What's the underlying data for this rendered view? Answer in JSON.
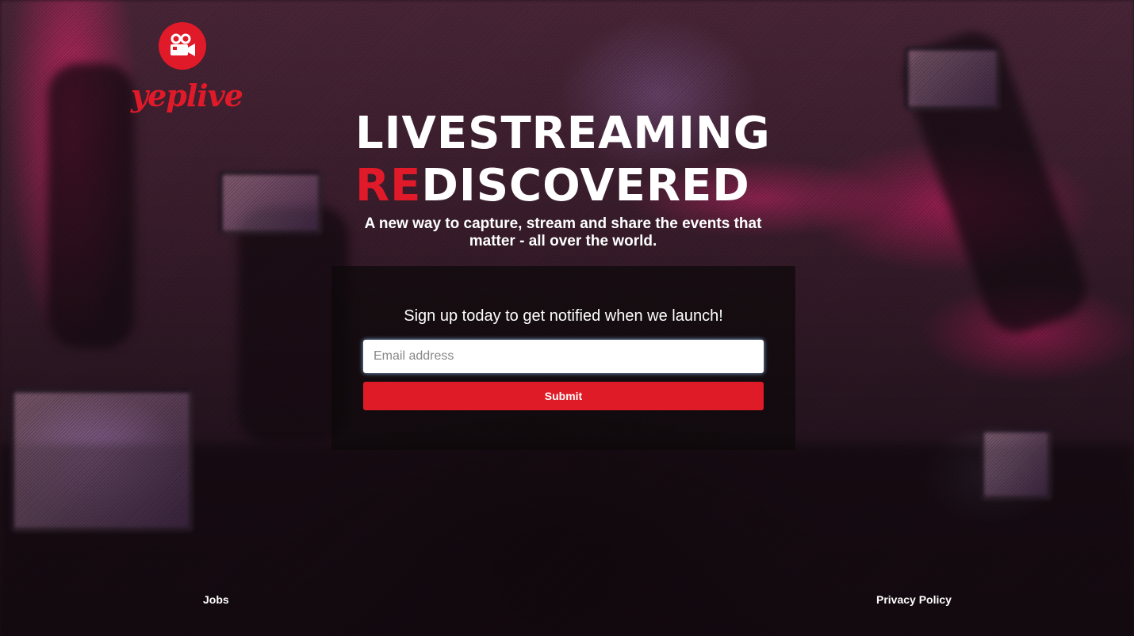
{
  "brand": {
    "name": "yeplive",
    "accent_color": "#e11a2a",
    "logo_icon": "video-camera-icon"
  },
  "hero": {
    "headline_line1": "LIVESTREAMING",
    "headline_line2_accent": "RE",
    "headline_line2_rest": "DISCOVERED",
    "subtitle": "A new way to capture, stream and share the events that matter - all over the world."
  },
  "signup": {
    "title": "Sign up today to get notified when we launch!",
    "email_placeholder": "Email address",
    "email_value": "",
    "submit_label": "Submit",
    "button_color": "#e01b28"
  },
  "footer": {
    "jobs_label": "Jobs",
    "privacy_label": "Privacy Policy"
  }
}
